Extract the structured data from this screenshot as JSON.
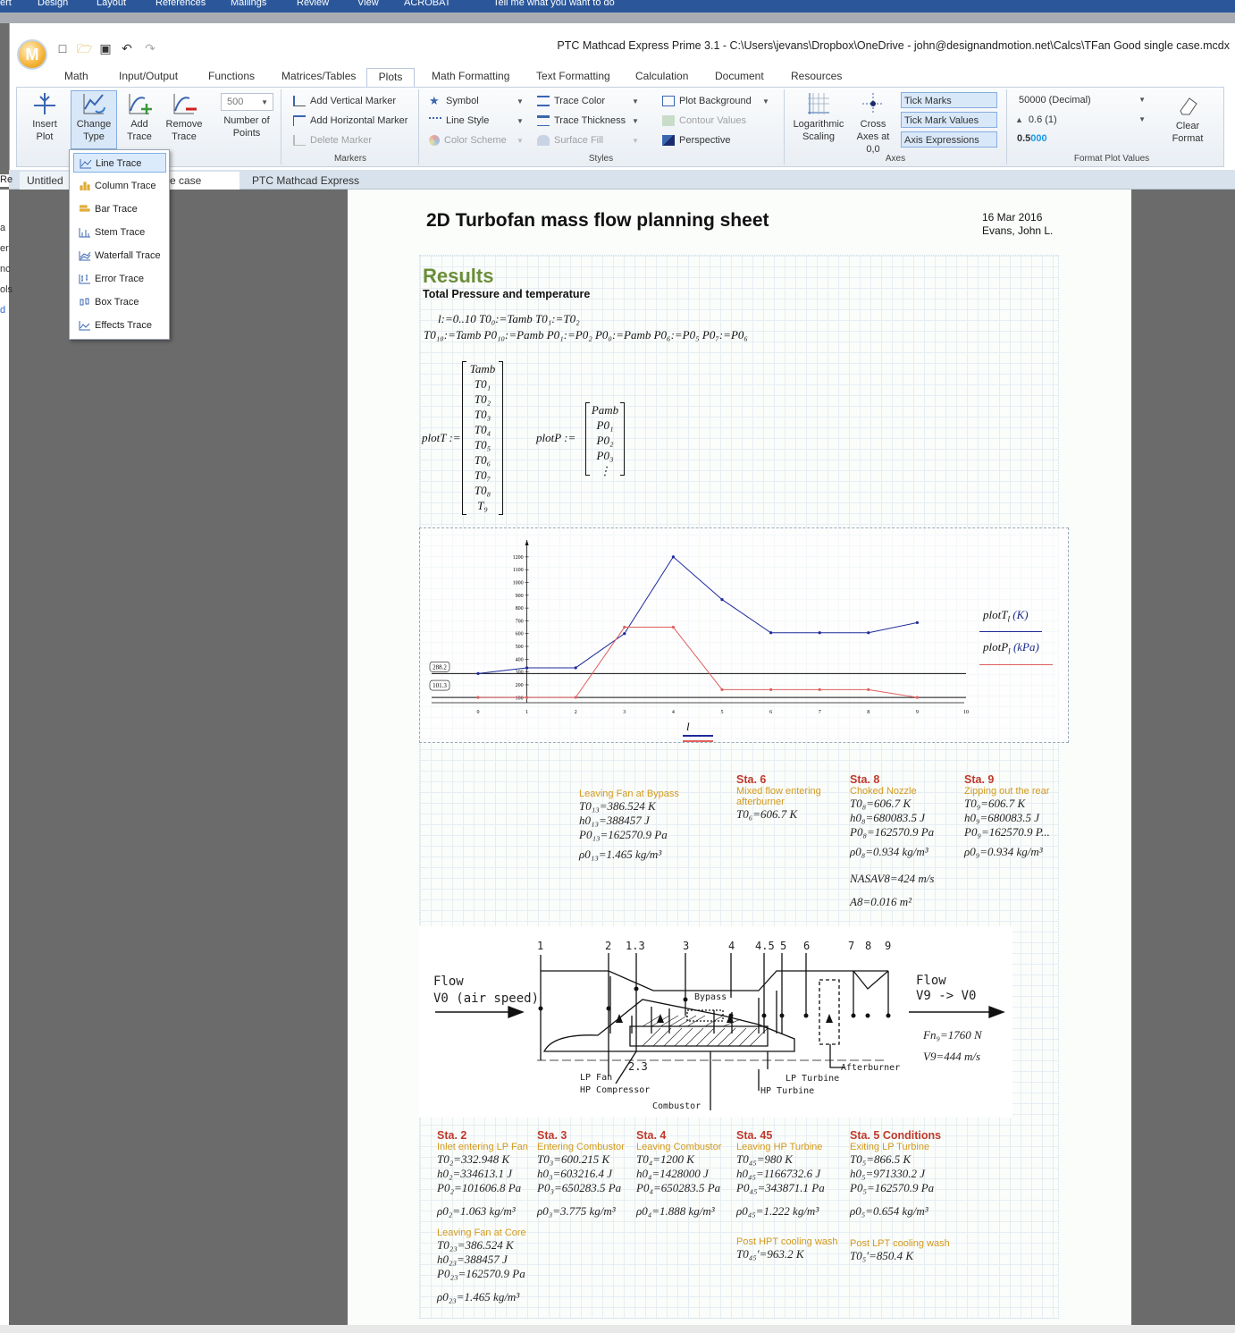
{
  "outer_bar": {
    "items": [
      "ert",
      "Design",
      "Layout",
      "References",
      "Mailings",
      "Review",
      "View",
      "ACROBAT",
      "Tell me what you want to do"
    ]
  },
  "title": "PTC Mathcad Express Prime 3.1 - C:\\Users\\jevans\\Dropbox\\OneDrive - john@designandmotion.net\\Calcs\\TFan Good single case.mcdx",
  "logo": "M",
  "tabs": [
    "Math",
    "Input/Output",
    "Functions",
    "Matrices/Tables",
    "Plots",
    "Math Formatting",
    "Text Formatting",
    "Calculation",
    "Document",
    "Resources"
  ],
  "active_tab": "Plots",
  "ribbon": {
    "insert_plot": "Insert Plot",
    "change_type": "Change Type",
    "add_trace": "Add Trace",
    "remove_trace": "Remove Trace",
    "num_points_value": "500",
    "num_points_label": "Number of Points",
    "traces_group": "",
    "markers": {
      "add_vertical": "Add Vertical Marker",
      "add_horizontal": "Add Horizontal Marker",
      "delete": "Delete Marker",
      "label": "Markers"
    },
    "styles": {
      "symbol": "Symbol",
      "line_style": "Line Style",
      "color_scheme": "Color Scheme",
      "trace_color": "Trace Color",
      "trace_thickness": "Trace Thickness",
      "surface_fill": "Surface Fill",
      "plot_background": "Plot Background",
      "contour_values": "Contour Values",
      "perspective": "Perspective",
      "label": "Styles"
    },
    "axes": {
      "log_scaling": "Logarithmic Scaling",
      "cross_axes": "Cross Axes at 0,0",
      "tick_marks": "Tick Marks",
      "tick_mark_values": "Tick Mark Values",
      "axis_expressions": "Axis Expressions",
      "label": "Axes"
    },
    "format": {
      "value1": "50000 (Decimal)",
      "value2": "0.6 (1)",
      "value3_a": "0.5",
      "value3_b": "000",
      "clear_format": "Clear Format",
      "label": "Format Plot Values"
    }
  },
  "doc_tabs": [
    "Untitled",
    "e case",
    "PTC Mathcad Express"
  ],
  "left_fragments": [
    "a",
    "er",
    "nc",
    "ols",
    "d"
  ],
  "change_type_menu": [
    "Line Trace",
    "Column Trace",
    "Bar Trace",
    "Stem Trace",
    "Waterfall Trace",
    "Error Trace",
    "Box Trace",
    "Effects Trace"
  ],
  "sheet": {
    "title": "2D Turbofan mass flow planning sheet",
    "date": "16 Mar 2016",
    "author": "Evans, John L.",
    "results_heading": "Results",
    "subheading": "Total Pressure and temperature",
    "def_line1": "l:=0..10   T0₀:=Tamb   T0₁:=T0₂",
    "def_line2": "T0₁₀:=Tamb  P0₁₀:=Pamb  P0₁:=P0₂  P0₀:=Pamb  P0₆:=P0₅  P0₇:=P0₆",
    "plotT_label": "plotT :=",
    "plotT_entries": [
      "Tamb",
      "T0₁",
      "T0₂",
      "T0₃",
      "T0₄",
      "T0₅",
      "T0₆",
      "T0₇",
      "T0₈",
      "T₉"
    ],
    "plotP_label": "plotP :=",
    "plotP_entries": [
      "Pamb",
      "P0₁",
      "P0₂",
      "P0₃",
      "⋮"
    ],
    "x_axis_label": "l",
    "legend_T": "plotT",
    "legend_T_unit": "(K)",
    "legend_P": "plotP",
    "legend_P_unit": "(kPa)",
    "legend_sub": "l"
  },
  "chart_data": {
    "type": "line",
    "x": [
      0,
      1,
      2,
      3,
      4,
      5,
      6,
      7,
      8,
      9
    ],
    "x_ticks": [
      "0",
      "1",
      "2",
      "3",
      "4",
      "5",
      "6",
      "7",
      "8",
      "9",
      "10"
    ],
    "y_ticks": [
      "100",
      "200",
      "300",
      "400",
      "500",
      "600",
      "700",
      "800",
      "900",
      "1000",
      "1100",
      "1200"
    ],
    "xlim": [
      0,
      10
    ],
    "ylim": [
      60,
      1290
    ],
    "series": [
      {
        "name": "plotT",
        "color": "#1f2a9a",
        "values": [
          288.2,
          332.9,
          332.9,
          600.2,
          1200,
          866.5,
          606.7,
          606.7,
          606.7,
          686
        ]
      },
      {
        "name": "plotP",
        "color": "#e06060",
        "values": [
          101.3,
          101.6,
          101.6,
          650.3,
          650.3,
          162.6,
          162.6,
          162.6,
          162.6,
          101.3
        ]
      }
    ],
    "markers": [
      {
        "axis": "y",
        "value": 288.2,
        "label": "288.2"
      },
      {
        "axis": "y",
        "value": 101.3,
        "label": "101.3"
      }
    ],
    "grid": false
  },
  "stations_top": [
    {
      "title": "",
      "sub": "Leaving Fan at Bypass",
      "rows": [
        "T0₁₃=386.524 K",
        "h0₁₃=388457 J",
        "P0₁₃=162570.9 Pa",
        "ρ0₁₃=1.465 kg/m³"
      ]
    },
    {
      "title": "Sta. 6",
      "sub": "Mixed flow entering afterburner",
      "rows": [
        "T0₆=606.7 K"
      ]
    },
    {
      "title": "Sta. 8",
      "sub": "Choked Nozzle",
      "rows": [
        "T0₈=606.7 K",
        "h0₈=680083.5 J",
        "P0₈=162570.9 Pa",
        "ρ0₈=0.934 kg/m³",
        "NASAV8=424 m/s",
        "A8=0.016 m²"
      ]
    },
    {
      "title": "Sta. 9",
      "sub": "Zipping out the rear",
      "rows": [
        "T0₉=606.7 K",
        "h0₉=680083.5 J",
        "P0₉=162570.9 P...",
        "ρ0₉=0.934 kg/m³"
      ]
    }
  ],
  "diagram": {
    "station_numbers": [
      "1",
      "2",
      "1.3",
      "3",
      "4",
      "4.5",
      "5",
      "6",
      "7",
      "8",
      "9"
    ],
    "flow_in": "Flow",
    "flow_in_sub": "V0 (air speed)",
    "flow_out": "Flow",
    "flow_out_sub": "V9 -> V0",
    "bypass": "Bypass",
    "lp_fan": "LP Fan",
    "hp_compressor": "HP Compressor",
    "combustor": "Combustor",
    "lp_turbine": "LP Turbine",
    "hp_turbine": "HP Turbine",
    "afterburner": "Afterburner",
    "station_23": "2.3",
    "fn9": "Fn₉=1760 N",
    "v9": "V9=444 m/s"
  },
  "stations_bottom": [
    {
      "title": "Sta. 2",
      "sub": "Inlet entering LP Fan",
      "rows": [
        "T0₂=332.948 K",
        "h0₂=334613.1 J",
        "P0₂=101606.8 Pa",
        "ρ0₂=1.063 kg/m³"
      ],
      "extra_sub": "Leaving Fan at Core",
      "extra_rows": [
        "T0₂₃=386.524 K",
        "h0₂₃=388457 J",
        "P0₂₃=162570.9 Pa",
        "ρ0₂₃=1.465 kg/m³"
      ]
    },
    {
      "title": "Sta. 3",
      "sub": "Entering Combustor",
      "rows": [
        "T0₃=600.215 K",
        "h0₃=603216.4 J",
        "P0₃=650283.5 Pa",
        "ρ0₃=3.775 kg/m³"
      ]
    },
    {
      "title": "Sta. 4",
      "sub": "Leaving Combustor",
      "rows": [
        "T0₄=1200 K",
        "h0₄=1428000 J",
        "P0₄=650283.5 Pa",
        "ρ0₄=1.888 kg/m³"
      ]
    },
    {
      "title": "Sta. 45",
      "sub": "Leaving HP Turbine",
      "rows": [
        "T0₄₅=980 K",
        "h0₄₅=1166732.6 J",
        "P0₄₅=343871.1 Pa",
        "ρ0₄₅=1.222 kg/m³"
      ],
      "extra_sub": "Post HPT cooling wash",
      "extra_rows": [
        "T0₄₅′=963.2 K"
      ]
    },
    {
      "title": "Sta. 5 Conditions",
      "sub": "Exiting LP Turbine",
      "rows": [
        "T0₅=866.5 K",
        "h0₅=971330.2 J",
        "P0₅=162570.9 Pa",
        "ρ0₅=0.654 kg/m³"
      ],
      "extra_sub": "Post LPT cooling wash",
      "extra_rows": [
        "T0₅′=850.4 K"
      ]
    }
  ]
}
